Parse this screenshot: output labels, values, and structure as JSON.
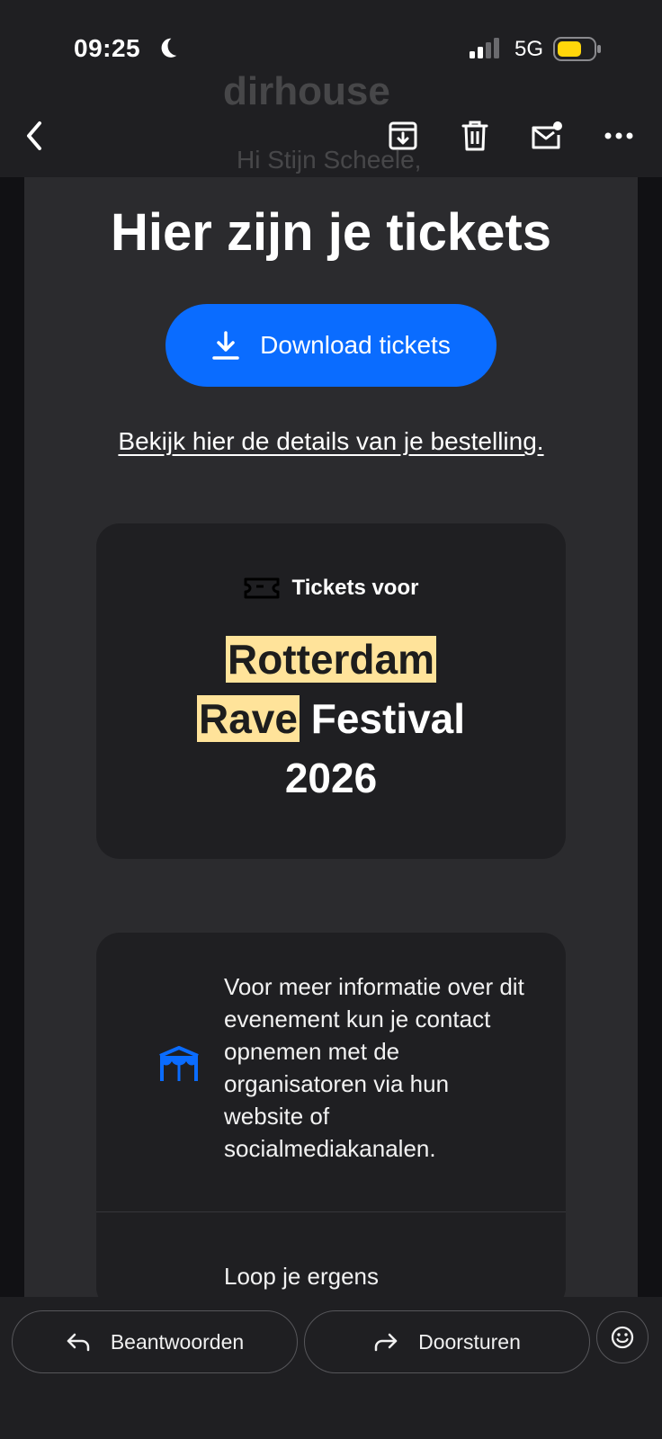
{
  "status_bar": {
    "time": "09:25",
    "network": "5G",
    "battery_color": "#ffd60a"
  },
  "nav": {
    "ghost_header": "dirhouse",
    "ghost_greeting": "Hi Stijn Scheele,"
  },
  "email": {
    "headline": "Hier zijn je tickets",
    "download_label": "Download tickets",
    "details_link": "Bekijk hier de details van je bestelling.",
    "tickets_for": "Tickets voor",
    "event_title": {
      "line1": "Rotterdam",
      "line2_highlight": "Rave",
      "line2_rest": " Festival",
      "line3": "2026"
    },
    "info_text": "Voor meer informatie over dit evenement kun je contact opnemen met de organisatoren via hun website of socialmediakanalen.",
    "loop_text": "Loop je ergens"
  },
  "bottom": {
    "reply_label": "Beantwoorden",
    "forward_label": "Doorsturen"
  },
  "colors": {
    "accent": "#0a6cff",
    "highlight": "#ffe39a",
    "bg": "#151517",
    "card": "#2b2b2e",
    "panel": "#1f1f22"
  },
  "icons": [
    "moon-icon",
    "signal-icon",
    "battery-icon",
    "back-icon",
    "archive-icon",
    "trash-icon",
    "mark-unread-icon",
    "more-icon",
    "download-icon",
    "ticket-icon",
    "venue-icon",
    "reply-icon",
    "forward-icon",
    "emoji-icon"
  ]
}
